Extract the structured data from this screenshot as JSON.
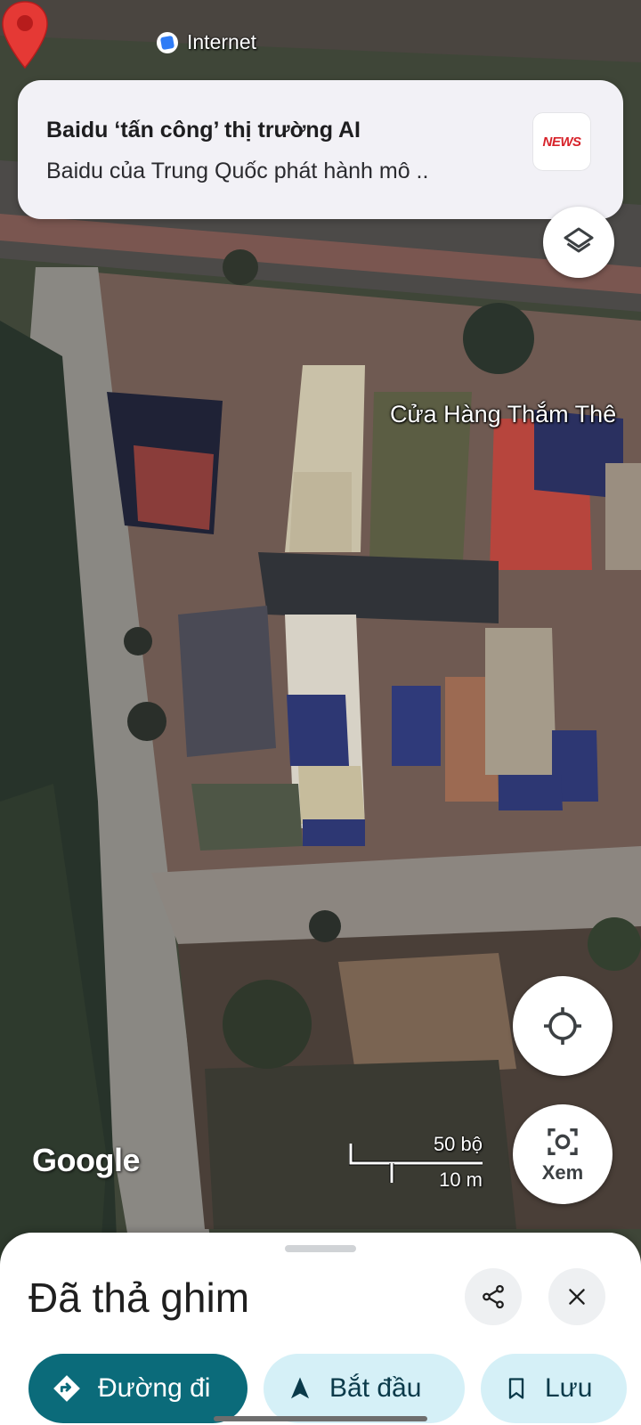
{
  "status": {
    "app_name": "Internet"
  },
  "notification": {
    "title": "Baidu ‘tấn công’ thị trường AI",
    "body": "Baidu của Trung Quốc phát hành mô ..",
    "thumbnail_text": "NEWS"
  },
  "map": {
    "place_label": "Cửa Hàng Thắm Thê",
    "google_logo": "Google",
    "scale_top": "50 bộ",
    "scale_bottom": "10 m",
    "pin_color": "#e53935"
  },
  "fabs": {
    "layers_icon": "layers-icon",
    "locate_icon": "my-location-icon",
    "lens_label": "Xem",
    "lens_icon": "camera-search-icon"
  },
  "sheet": {
    "title": "Đã thả ghim",
    "share_icon": "share-icon",
    "close_icon": "close-icon",
    "actions": [
      {
        "label": "Đường đi",
        "icon": "directions-icon"
      },
      {
        "label": "Bắt đầu",
        "icon": "navigation-arrow-icon"
      },
      {
        "label": "Lưu",
        "icon": "bookmark-icon"
      }
    ]
  },
  "colors": {
    "primary": "#0b6b7a",
    "chip_secondary": "#d5f0f7",
    "pin": "#e53935"
  }
}
